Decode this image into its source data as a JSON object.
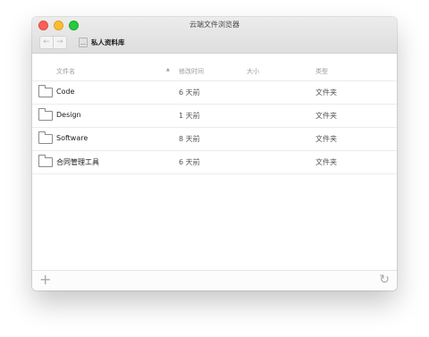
{
  "window": {
    "title": "云端文件浏览器"
  },
  "toolbar": {
    "back_icon": "←",
    "forward_icon": "→",
    "location_label": "私人资料库"
  },
  "columns": {
    "name": "文件名",
    "sort_indicator": "▲",
    "modified": "修改时间",
    "size": "大小",
    "type": "类型"
  },
  "rows": [
    {
      "name": "Code",
      "modified": "6 天前",
      "size": "",
      "type": "文件夹"
    },
    {
      "name": "Design",
      "modified": "1 天前",
      "size": "",
      "type": "文件夹"
    },
    {
      "name": "Software",
      "modified": "8 天前",
      "size": "",
      "type": "文件夹"
    },
    {
      "name": "合同管理工具",
      "modified": "6 天前",
      "size": "",
      "type": "文件夹"
    }
  ],
  "footer": {
    "add_icon": "+",
    "refresh_icon": "↻"
  }
}
